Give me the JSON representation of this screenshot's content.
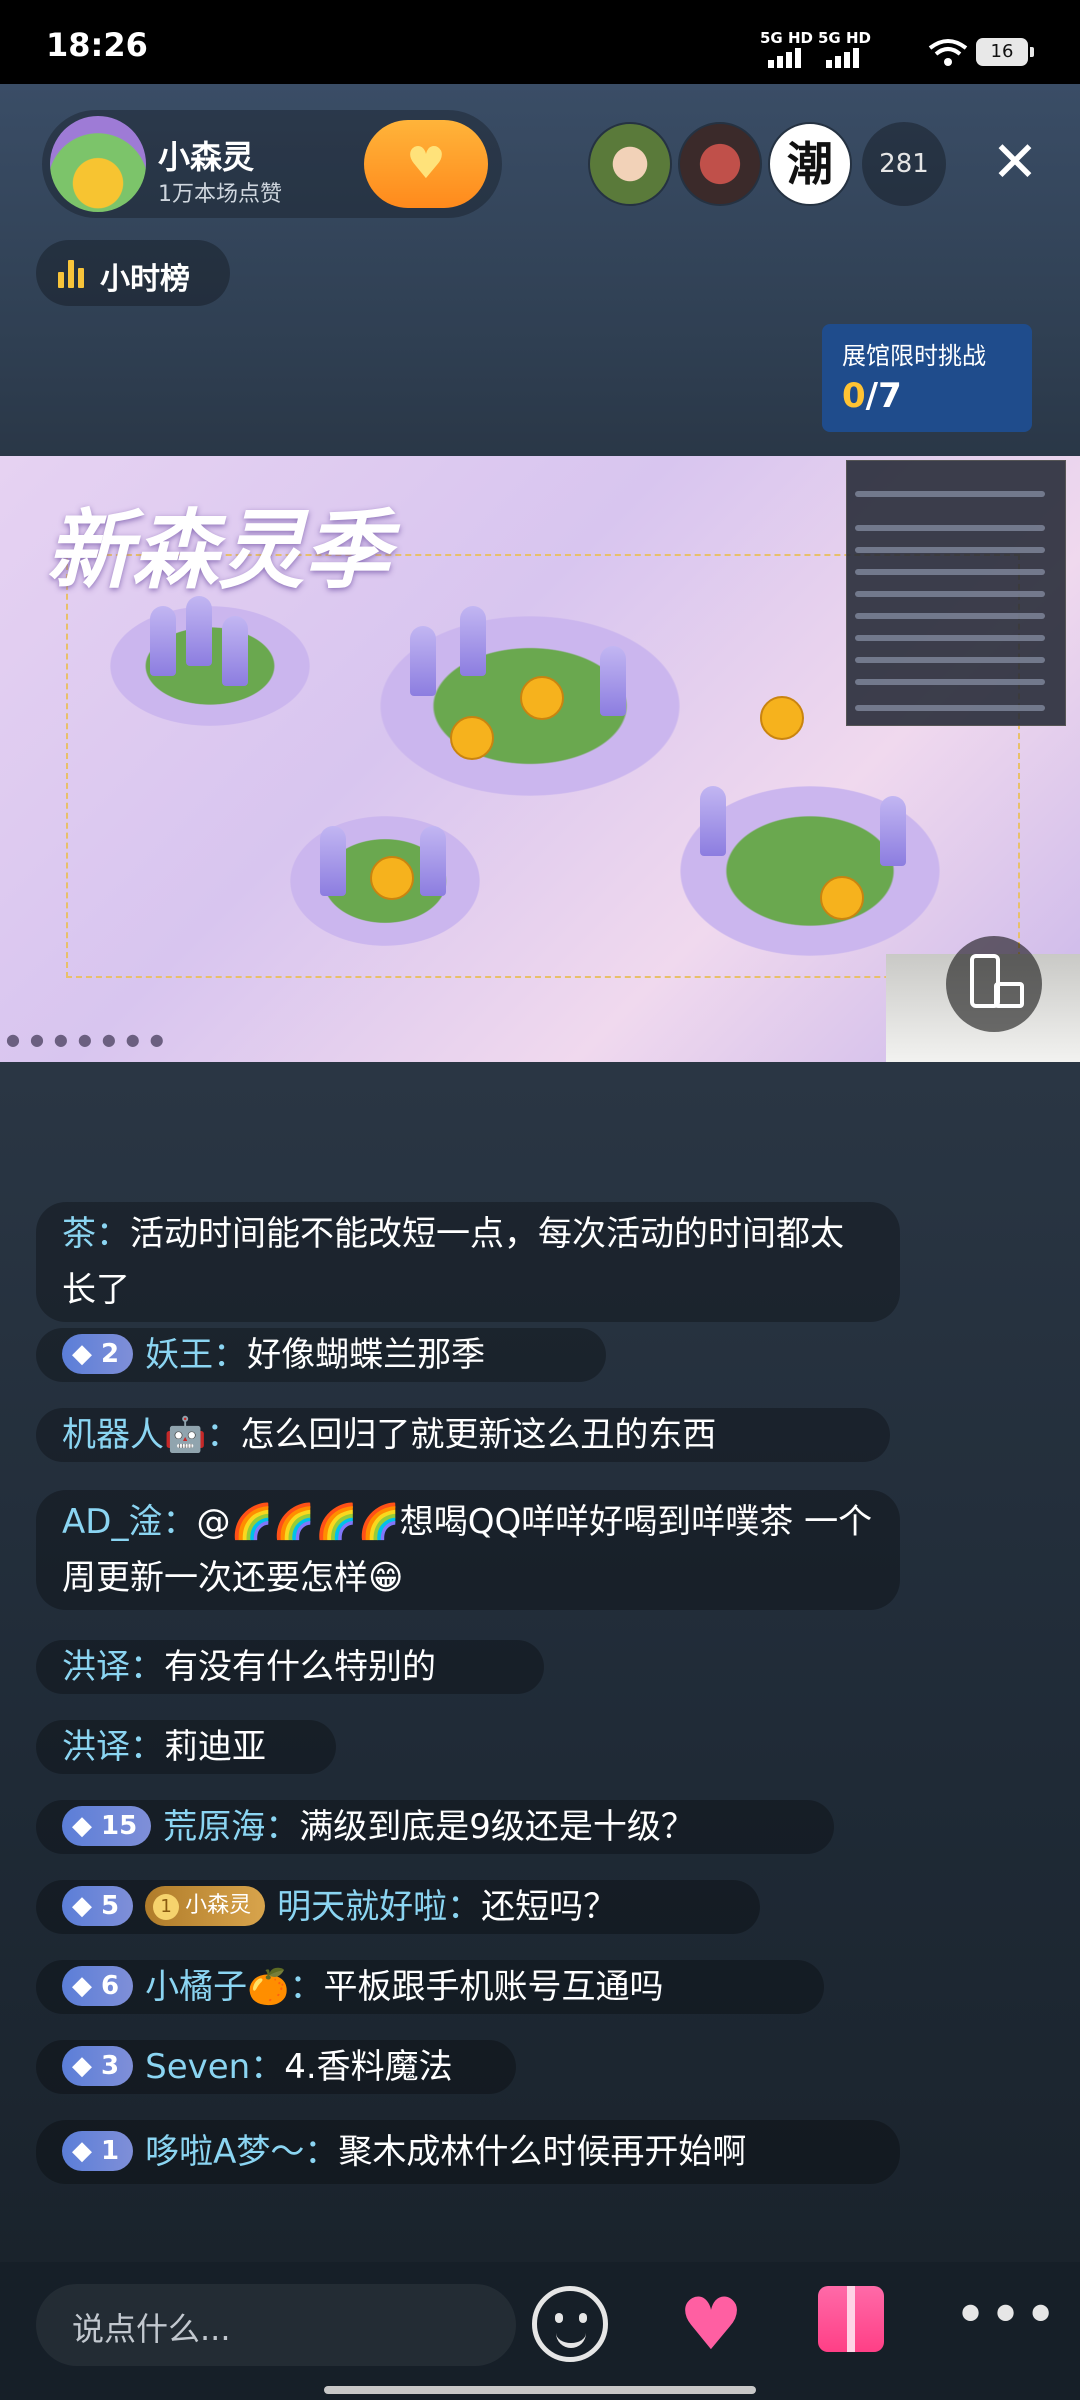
{
  "status_bar": {
    "time": "18:26",
    "net1": "5G HD",
    "net2": "5G HD",
    "battery": "16"
  },
  "header": {
    "host_name": "小森灵",
    "host_subtitle": "1万本场点赞",
    "viewer_count": "281",
    "viewers": [
      "viewer-1",
      "viewer-2",
      "潮"
    ],
    "rank_label": "小时榜",
    "challenge_title": "展馆限时挑战",
    "challenge_current": "0",
    "challenge_total": "/7"
  },
  "stream": {
    "banner_title": "新森灵季"
  },
  "chat": [
    {
      "name": "茶：",
      "text": "活动时间能不能改短一点，每次活动的时间都太长了"
    },
    {
      "level": "2",
      "name": "妖王：",
      "text": "好像蝴蝶兰那季"
    },
    {
      "name": "机器人🤖：",
      "text": "怎么回归了就更新这么丑的东西"
    },
    {
      "name": "AD_淦：",
      "text": "@🌈🌈🌈🌈想喝QQ咩咩好喝到咩噗茶 一个周更新一次还要怎样😁"
    },
    {
      "name": "洪译：",
      "text": "有没有什么特别的"
    },
    {
      "name": "洪译：",
      "text": "莉迪亚"
    },
    {
      "level": "15",
      "name": "荒原海：",
      "text": "满级到底是9级还是十级？"
    },
    {
      "level": "5",
      "fan_level": "1",
      "fan_club": "小森灵",
      "name": "明天就好啦：",
      "text": "还短吗？"
    },
    {
      "level": "6",
      "name": "小橘子🍊：",
      "text": "平板跟手机账号互通吗"
    },
    {
      "level": "3",
      "name": "Seven：",
      "text": "4.香料魔法"
    },
    {
      "level": "1",
      "name": "哆啦A梦～：",
      "text": "聚木成林什么时候再开始啊"
    }
  ],
  "bottom": {
    "input_placeholder": "说点什么..."
  },
  "colors": {
    "accent": "#ffb43a",
    "username": "#8bd5f2",
    "challenge_bg": "#1f4c8c",
    "level_badge": "#5b7ed8"
  },
  "icons": [
    "close-icon",
    "heart-plus-icon",
    "rank-bars-icon",
    "smile-icon",
    "like-heart-icon",
    "gift-icon",
    "more-icon",
    "camera-switch-icon"
  ]
}
